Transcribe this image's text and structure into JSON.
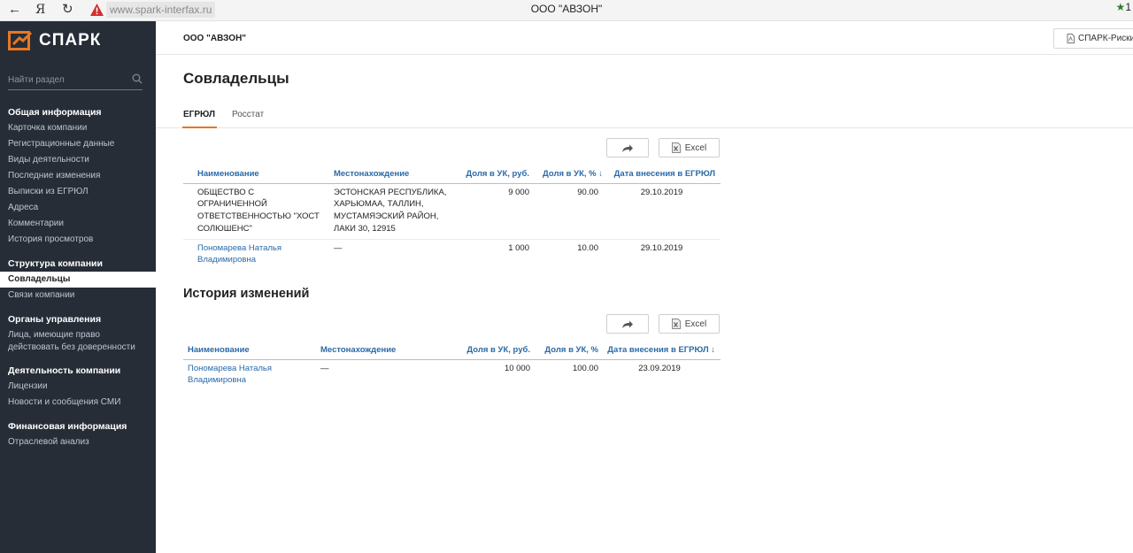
{
  "browser": {
    "back": "←",
    "ya": "Я",
    "reload": "↻",
    "url": "www.spark-interfax.ru",
    "tab_title": "ООО \"АВЗОН\"",
    "star": "★",
    "star_count": "1"
  },
  "sidebar": {
    "logo": "СПАРК",
    "search_placeholder": "Найти раздел",
    "groups": [
      {
        "title": "Общая информация",
        "items": [
          "Карточка компании",
          "Регистрационные данные",
          "Виды деятельности",
          "Последние изменения",
          "Выписки из ЕГРЮЛ",
          "Адреса",
          "Комментарии",
          "История просмотров"
        ]
      },
      {
        "title": "Структура компании",
        "items": [
          "Совладельцы",
          "Связи компании"
        ],
        "active": "Совладельцы"
      },
      {
        "title": "Органы управления",
        "items": [
          "Лица, имеющие право действовать без доверенности"
        ]
      },
      {
        "title": "Деятельность компании",
        "items": [
          "Лицензии",
          "Новости и сообщения СМИ"
        ]
      },
      {
        "title": "Финансовая информация",
        "items": [
          "Отраслевой анализ"
        ]
      }
    ]
  },
  "header": {
    "company": "ООО \"АВЗОН\"",
    "risk_button": "СПАРК-Риски"
  },
  "page": {
    "title": "Совладельцы",
    "tabs": [
      "ЕГРЮЛ",
      "Росстат"
    ],
    "active_tab": "ЕГРЮЛ",
    "excel_label": "Excel"
  },
  "owners": {
    "columns": [
      "Наименование",
      "Местонахождение",
      "Доля в УК, руб.",
      "Доля в УК, % ↓",
      "Дата внесения в ЕГРЮЛ"
    ],
    "rows": [
      {
        "name": "ОБЩЕСТВО С ОГРАНИЧЕННОЙ ОТВЕТСТВЕННОСТЬЮ \"ХОСТ СОЛЮШЕНС\"",
        "location": "ЭСТОНСКАЯ РЕСПУБЛИКА, ХАРЬЮМАА, ТАЛЛИН, МУСТАМЯЭСКИЙ РАЙОН, ЛАКИ 30, 12915",
        "share_rub": "9 000",
        "share_pct": "90.00",
        "date": "29.10.2019"
      },
      {
        "name": "Пономарева Наталья Владимировна",
        "location": "—",
        "share_rub": "1 000",
        "share_pct": "10.00",
        "date": "29.10.2019"
      }
    ]
  },
  "history": {
    "title": "История изменений",
    "columns": [
      "Наименование",
      "Местонахождение",
      "Доля в УК, руб.",
      "Доля в УК, %",
      "Дата внесения в ЕГРЮЛ ↓"
    ],
    "rows": [
      {
        "name": "Пономарева Наталья Владимировна",
        "location": "—",
        "share_rub": "10 000",
        "share_pct": "100.00",
        "date": "23.09.2019"
      }
    ]
  },
  "colors": {
    "sidebar_bg": "#262d37",
    "accent": "#e87722",
    "link": "#2a6aa8",
    "warning": "#d32f2f"
  },
  "icons": [
    "back-arrow-icon",
    "reload-icon",
    "warning-icon",
    "star-icon",
    "spark-logo-icon",
    "search-icon",
    "pdf-icon",
    "share-icon",
    "excel-icon"
  ]
}
